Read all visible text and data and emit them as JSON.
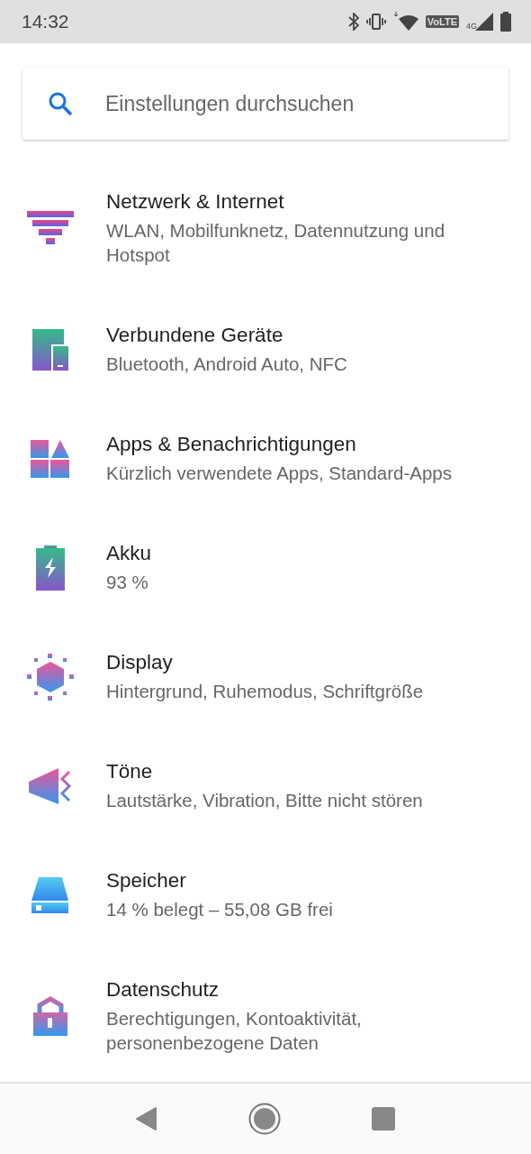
{
  "status_bar": {
    "time": "14:32",
    "volte": "VoLTE",
    "network_type": "4G"
  },
  "search": {
    "placeholder": "Einstellungen durchsuchen"
  },
  "items": [
    {
      "kind": "network",
      "title": "Netzwerk & Internet",
      "subtitle": "WLAN, Mobilfunknetz, Datennutzung und Hotspot"
    },
    {
      "kind": "devices",
      "title": "Verbundene Geräte",
      "subtitle": "Bluetooth, Android Auto, NFC"
    },
    {
      "kind": "apps",
      "title": "Apps & Benachrichtigungen",
      "subtitle": "Kürzlich verwendete Apps, Standard-Apps"
    },
    {
      "kind": "battery",
      "title": "Akku",
      "subtitle": "93 %"
    },
    {
      "kind": "display",
      "title": "Display",
      "subtitle": "Hintergrund, Ruhemodus, Schriftgröße"
    },
    {
      "kind": "sound",
      "title": "Töne",
      "subtitle": "Lautstärke, Vibration, Bitte nicht stören"
    },
    {
      "kind": "storage",
      "title": "Speicher",
      "subtitle": "14 % belegt – 55,08 GB frei"
    },
    {
      "kind": "privacy",
      "title": "Datenschutz",
      "subtitle": "Berechtigungen, Kontoaktivität, personenbezogene Daten"
    }
  ]
}
